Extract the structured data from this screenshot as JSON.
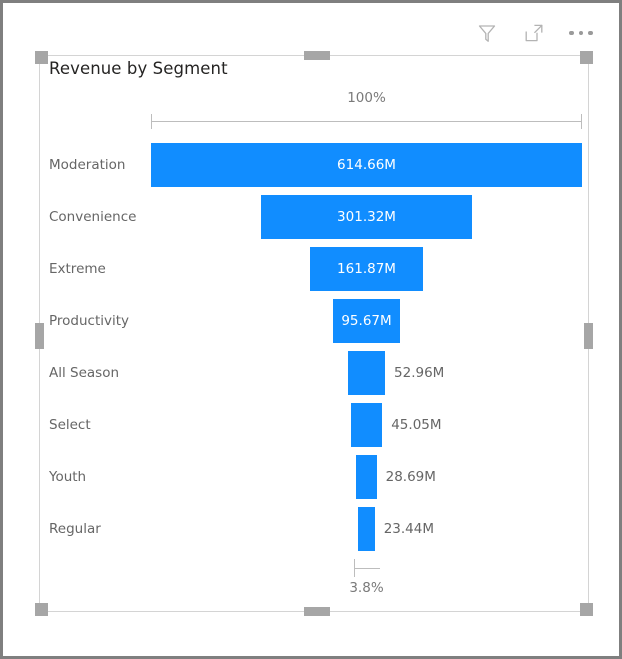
{
  "visual": {
    "title": "Revenue by Segment",
    "accent_color": "#118DFF",
    "label_color": "#666666",
    "axis_color": "#7a7a7a"
  },
  "header": {
    "filter_icon": "filter-icon",
    "focus_icon": "focus-mode-icon",
    "more_icon": "more-options-icon"
  },
  "chart_data": {
    "type": "bar",
    "subtype": "funnel",
    "title": "Revenue by Segment",
    "xlabel": "",
    "ylabel": "",
    "orientation": "horizontal-centered",
    "grid": false,
    "legend": "none",
    "top_percent_label": "100%",
    "bottom_percent_label": "3.8%",
    "categories": [
      "Moderation",
      "Convenience",
      "Extreme",
      "Productivity",
      "All Season",
      "Select",
      "Youth",
      "Regular"
    ],
    "values": [
      614.66,
      301.32,
      161.87,
      95.67,
      52.96,
      45.05,
      28.69,
      23.44
    ],
    "value_labels": [
      "614.66M",
      "301.32M",
      "161.87M",
      "95.67M",
      "52.96M",
      "45.05M",
      "28.69M",
      "23.44M"
    ],
    "label_placement": [
      "inside",
      "inside",
      "inside",
      "inside",
      "outside",
      "outside",
      "outside",
      "outside"
    ],
    "bar_width_pct": [
      100.0,
      49.0,
      26.3,
      15.6,
      8.6,
      7.3,
      4.7,
      3.8
    ],
    "units": "M",
    "xlim": [
      0,
      614.66
    ]
  }
}
